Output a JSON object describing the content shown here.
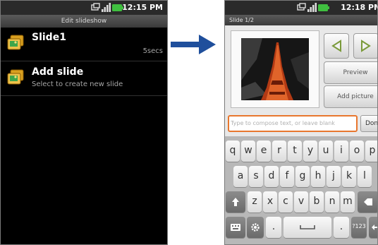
{
  "left_screen": {
    "status_time": "12:15 PM",
    "title": "Edit slideshow",
    "items": [
      {
        "title": "Slide1",
        "meta": "5secs",
        "subtitle": ""
      },
      {
        "title": "Add slide",
        "meta": "",
        "subtitle": "Select to create new slide"
      }
    ]
  },
  "right_screen": {
    "status_time": "12:18 PM",
    "title": "Slide 1/2",
    "buttons": {
      "preview": "Preview",
      "add_picture": "Add picture",
      "done": "Done"
    },
    "compose_placeholder": "Type to compose text, or leave blank",
    "keyboard": {
      "row1": [
        "q",
        "w",
        "e",
        "r",
        "t",
        "y",
        "u",
        "i",
        "o",
        "p"
      ],
      "row2": [
        "a",
        "s",
        "d",
        "f",
        "g",
        "h",
        "j",
        "k",
        "l"
      ],
      "row3": [
        "z",
        "x",
        "c",
        "v",
        "b",
        "n",
        "m"
      ],
      "row4": [
        ".",
        "",
        ".",
        "?123"
      ]
    }
  },
  "colors": {
    "arrow": "#1f4f9c",
    "input_focus": "#e8772e",
    "battery": "#3fbf3f"
  }
}
